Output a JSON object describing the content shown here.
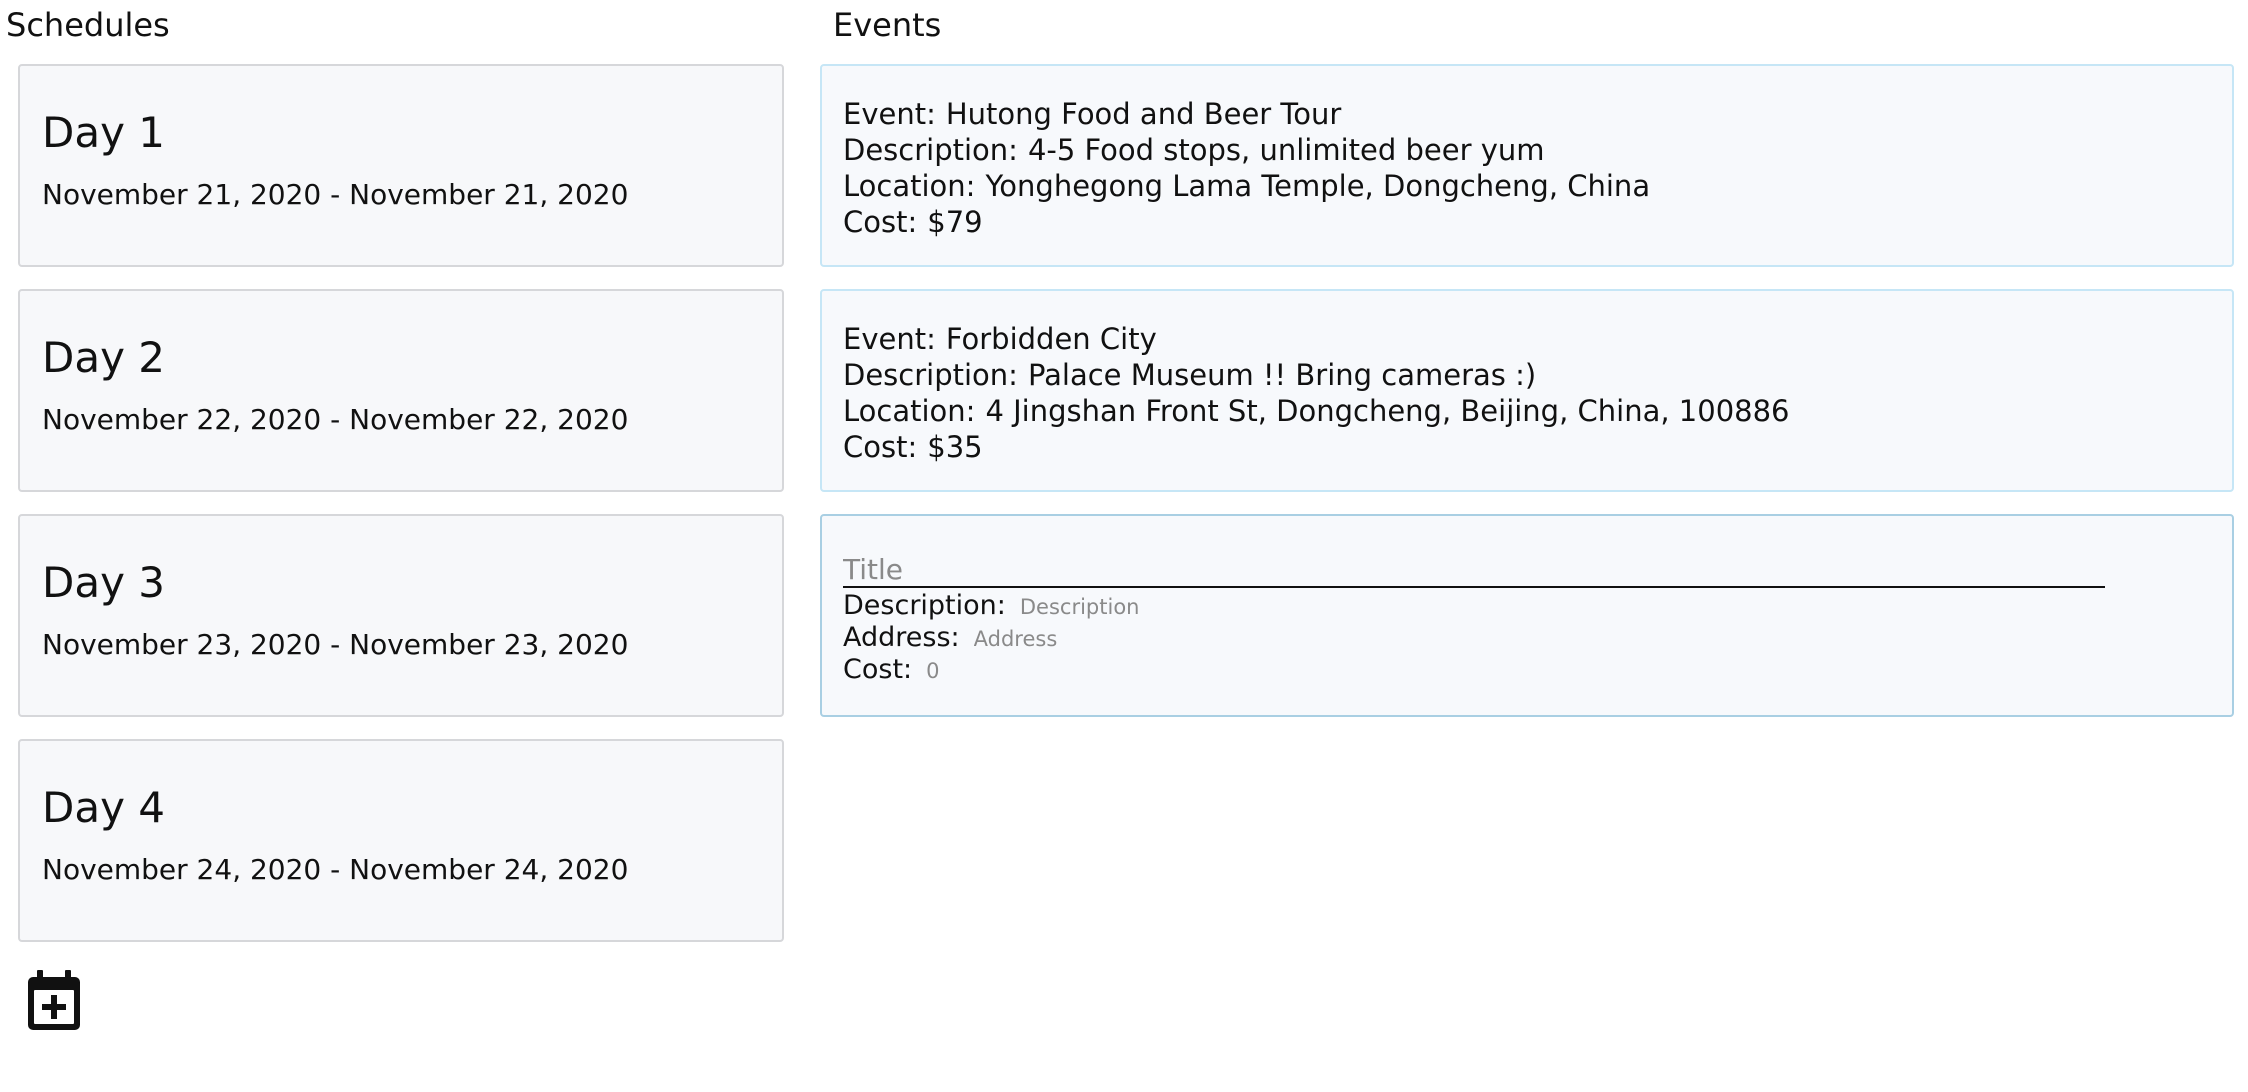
{
  "schedules_heading": "Schedules",
  "events_heading": "Events",
  "schedules": [
    {
      "title": "Day 1",
      "range": "November 21, 2020 - November 21, 2020"
    },
    {
      "title": "Day 2",
      "range": "November 22, 2020 - November 22, 2020"
    },
    {
      "title": "Day 3",
      "range": "November 23, 2020 - November 23, 2020"
    },
    {
      "title": "Day 4",
      "range": "November 24, 2020 - November 24, 2020"
    }
  ],
  "event_labels": {
    "event": "Event:",
    "description": "Description:",
    "location": "Location:",
    "cost": "Cost:"
  },
  "events": [
    {
      "name": "Hutong Food and Beer Tour",
      "description": "4-5 Food stops, unlimited beer yum",
      "location": "Yonghegong Lama Temple, Dongcheng, China",
      "cost": "$79"
    },
    {
      "name": "Forbidden City",
      "description": "Palace Museum !! Bring cameras :)",
      "location": "4 Jingshan Front St, Dongcheng, Beijing, China, 100886",
      "cost": "$35"
    }
  ],
  "new_event_form": {
    "title_placeholder": "Title",
    "title_value": "",
    "description_label": "Description:",
    "description_placeholder": "Description",
    "address_label": "Address:",
    "address_placeholder": "Address",
    "cost_label": "Cost:",
    "cost_placeholder": "0"
  },
  "icons": {
    "add_schedule": "calendar-plus-icon"
  },
  "colors": {
    "schedule_card_border": "#d6d7da",
    "event_card_border": "#c6e6f6",
    "form_border": "#a9cfe3",
    "card_background": "#f7f8fa"
  }
}
